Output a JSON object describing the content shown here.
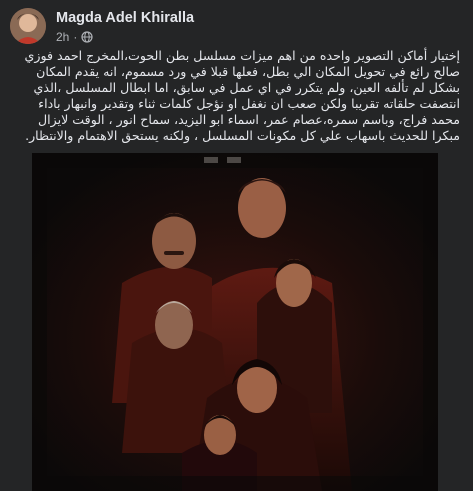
{
  "post": {
    "author": "Magda Adel Khiralla",
    "time": "2h",
    "separator": "·",
    "privacy_icon": "globe-icon",
    "text": "إختيار أماكن التصوير واحده من اهم ميزات مسلسل بطن الحوت،المخرج احمد فوزي صالح رائع في تحويل المكان الي بطل، فعلها قبلا في ورد مسموم، انه يقدم المكان  بشكل لم تألفه العين، ولم يتكرر في اي عمل في سابق، اما  ابطال المسلسل ،الذي انتصفت حلقاته تقريبا ولكن صعب ان نغفل او نؤجل كلمات ثناء وتقدير وانبهار باداء  محمد فراج، وباسم سمره،عصام عمر، اسماء ابو اليزيد، سماح انور ، الوقت لايزال مبكرا للحديث باسهاب علي كل مكونات المسلسل ، ولكنه يستحق الاهتمام والانتظار."
  },
  "media": {
    "type": "poster-image",
    "colors": {
      "bg": "#0f0d0d",
      "red": "#7a1c14",
      "skin": "#a0674a"
    }
  }
}
